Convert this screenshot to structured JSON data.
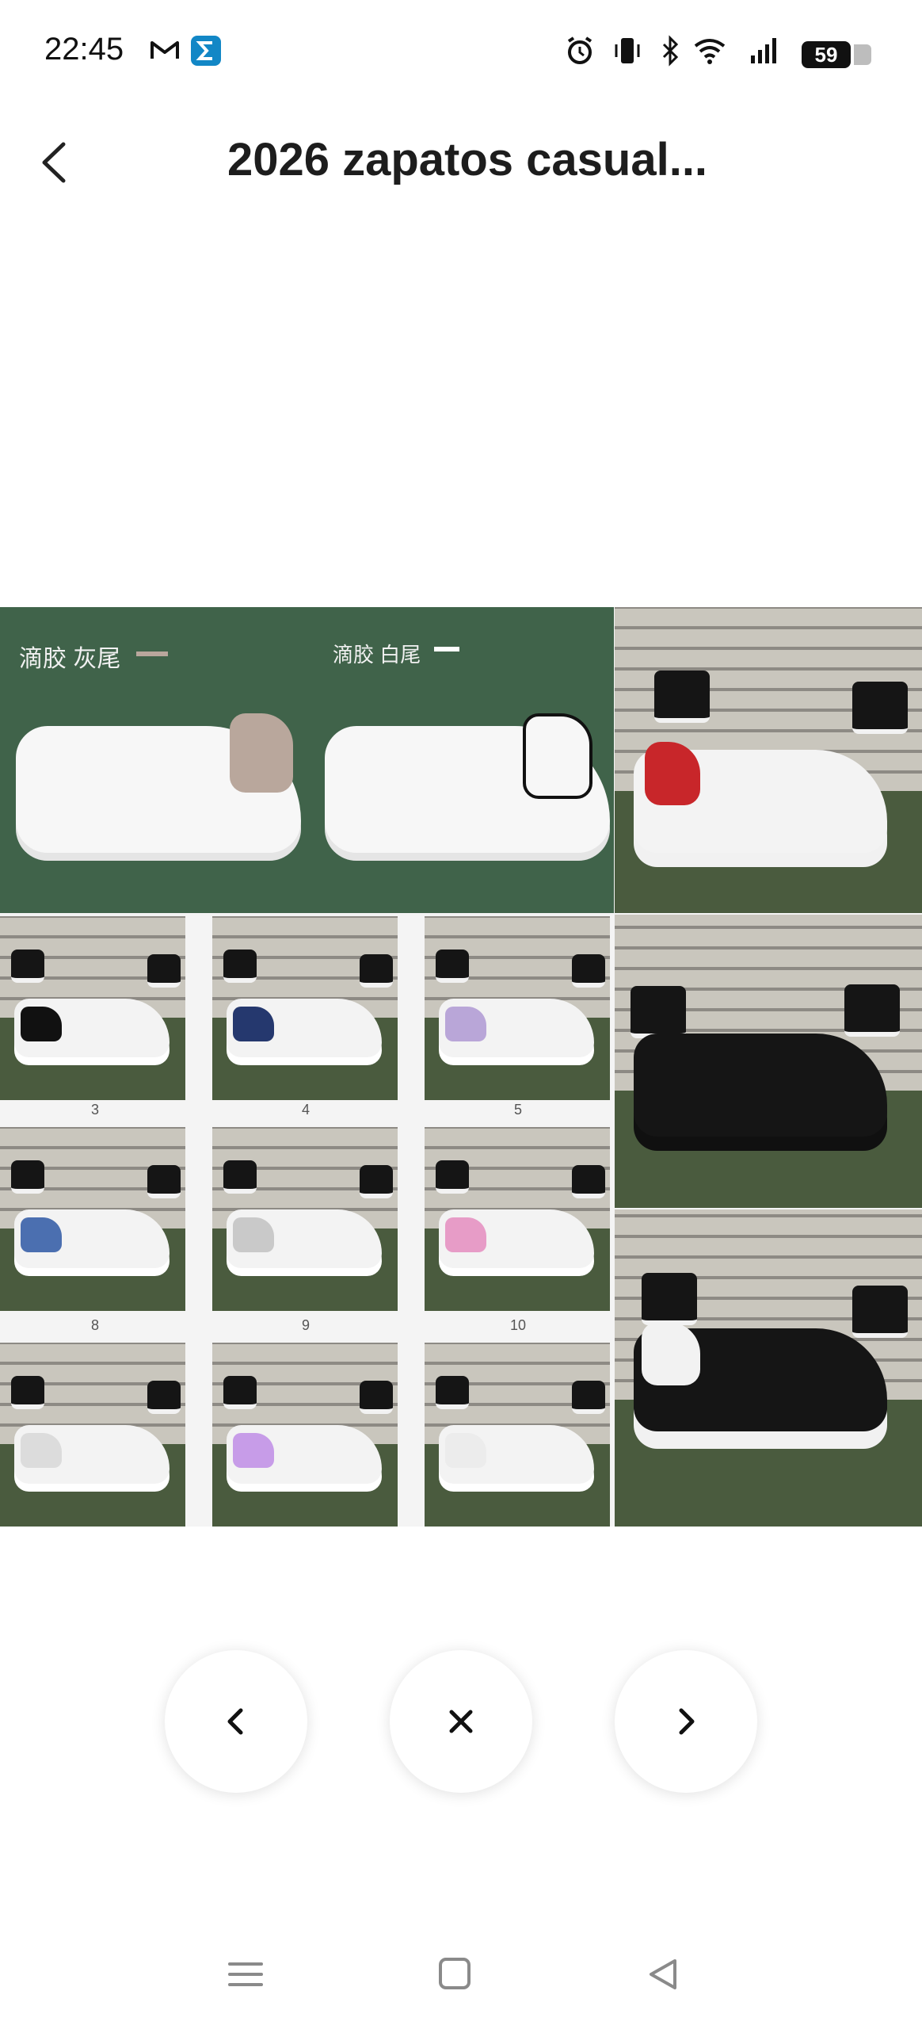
{
  "status_bar": {
    "time": "22:45",
    "battery": "59",
    "icons": [
      "gmail-icon",
      "sigma-app-icon",
      "alarm-icon",
      "vibrate-icon",
      "bluetooth-icon",
      "wifi-icon",
      "signal-icon",
      "battery-icon"
    ]
  },
  "header": {
    "title": "2026 zapatos casual...",
    "back_icon": "chevron-left-icon"
  },
  "image": {
    "labels": {
      "gray_tail": "滴胶 灰尾",
      "white_tail": "滴胶 白尾"
    },
    "thumb_numbers": [
      "3",
      "4",
      "5",
      "8",
      "9",
      "10"
    ],
    "colors": {
      "green_bg": "#40634a",
      "gray_heel": "#b9a79c",
      "red_heel": "#c8262a",
      "black_heel": "#111111",
      "navy_heel": "#25386e",
      "iridescent_heel": "#b9a6d8",
      "blue_heel": "#4b6fb0",
      "silver_heel": "#c9c9c9",
      "pink_heel": "#e79cc7",
      "holo_heel": "#c79ce8"
    }
  },
  "controls": {
    "prev_icon": "chevron-left-icon",
    "close_icon": "close-icon",
    "next_icon": "chevron-right-icon"
  },
  "system_nav": {
    "menu_icon": "menu-icon",
    "home_icon": "home-icon",
    "back_icon": "back-triangle-icon"
  }
}
